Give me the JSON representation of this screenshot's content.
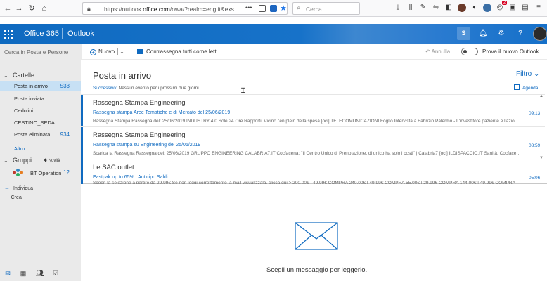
{
  "browser": {
    "url_prefix": "https://outlook.",
    "url_domain": "office.com",
    "url_suffix": "/owa/?realm=eng.it&exs",
    "more": "•••",
    "search_placeholder": "Cerca",
    "badge": "2"
  },
  "header": {
    "brand": "Office 365",
    "app": "Outlook",
    "skype": "S",
    "help": "?"
  },
  "commandbar": {
    "search_placeholder": "Cerca in Posta e Persone",
    "new_label": "Nuovo",
    "mark_all_label": "Contrassegna tutti come letti",
    "undo_label": "Annulla",
    "try_new_label": "Prova il nuovo Outlook"
  },
  "sidebar": {
    "folders_title": "Cartelle",
    "folders": [
      {
        "label": "Posta in arrivo",
        "count": "533"
      },
      {
        "label": "Posta inviata",
        "count": ""
      },
      {
        "label": "Cedolini",
        "count": ""
      },
      {
        "label": "CESTINO_SEDA",
        "count": ""
      },
      {
        "label": "Posta eliminata",
        "count": "934"
      }
    ],
    "more_label": "Altro",
    "groups_title": "Gruppi",
    "groups_new": "Novità",
    "group": {
      "label": "BT Operation",
      "count": "12"
    },
    "discover_label": "Individua",
    "create_label": "Crea"
  },
  "inbox": {
    "title": "Posta in arrivo",
    "filter_label": "Filtro",
    "next_prefix": "Successivo:",
    "next_text": "Nessun evento per i prossimi due giorni.",
    "agenda_label": "Agenda",
    "messages": [
      {
        "sender": "Rassegna Stampa Engineering",
        "subject": "Rassegna stampa Aree Tematiche e di Mercato del 25/06/2019",
        "preview": "Rassegna Stampa Rassegna del: 25/06/2019 INDUSTRY 4.0 Sole 24 Ore Rapporti: Vicino l'en plein della spesa [oci] TELECOMUNICAZIONI Foglio Intervista a Fabrizio Palermo - L'investitore paziente e l'azio...",
        "time": "09:13"
      },
      {
        "sender": "Rassegna Stampa Engineering",
        "subject": "Rassegna stampa su Engineering del 25/06/2019",
        "preview": "Scarica la Rassegna Rassegna del: 25/06/2019 GRUPPO ENGINEERING CALABRIA7.IT Cocfacena: \"Il Centro Unico di Prenotazione, di unico ha solo i costi\" | Calabria7 [oci] ILDISPACCIO.IT Sanità, Cocfacena: \"C...",
        "time": "08:59"
      },
      {
        "sender": "Le SAC outlet",
        "subject": "Eastpak up to 65% | Anticipo Saldi",
        "preview": "Scopri la selezione a partire da 29,99€ Se non leggi correttamente la mail visualizzala, clicca qui > 200,00€ | 49,99€ COMPRA 240,00€ | 49,99€ COMPRA 55,00€ | 29,99€ COMPRA 144,00€ | 49,99€ COMPRA",
        "time": "05:06"
      }
    ]
  },
  "reading": {
    "hint": "Scegli un messaggio per leggerlo."
  },
  "colors": {
    "accent": "#0f6ac0",
    "selected": "#c7e0f4",
    "nav_bg": "#eaeaea"
  }
}
